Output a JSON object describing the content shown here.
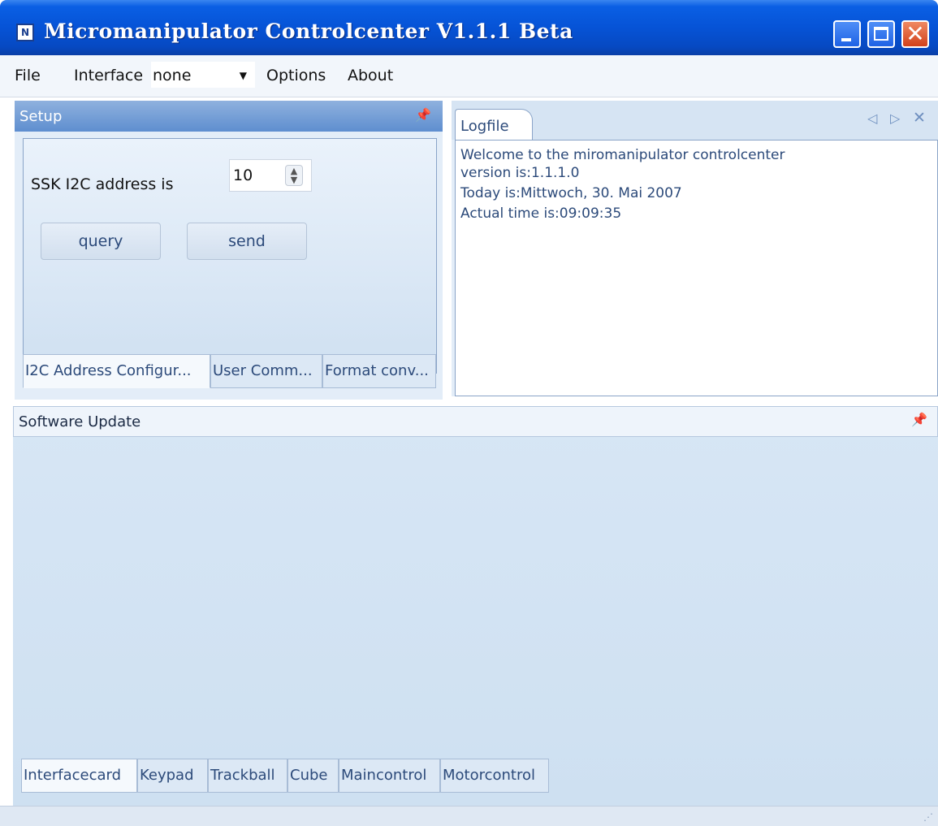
{
  "window": {
    "title": "Micromanipulator Controlcenter V1.1.1 Beta",
    "icon_text": "N"
  },
  "menu": {
    "file": "File",
    "interface": "Interface",
    "interface_value": "none",
    "options": "Options",
    "about": "About"
  },
  "setup": {
    "title": "Setup",
    "address_label": "SSK I2C address is",
    "address_value": "10",
    "query_button": "query",
    "send_button": "send",
    "tabs": [
      "I2C Address Configur...",
      "User Comm...",
      "Format conv..."
    ]
  },
  "logfile": {
    "tab_label": "Logfile",
    "lines": [
      "Welcome to the miromanipulator controlcenter",
      "version is:1.1.1.0",
      "Today is:Mittwoch, 30. Mai 2007",
      "Actual time is:09:09:35"
    ]
  },
  "update": {
    "title": "Software Update",
    "tabs": [
      "Interfacecard",
      "Keypad",
      "Trackball",
      "Cube",
      "Maincontrol",
      "Motorcontrol"
    ]
  }
}
